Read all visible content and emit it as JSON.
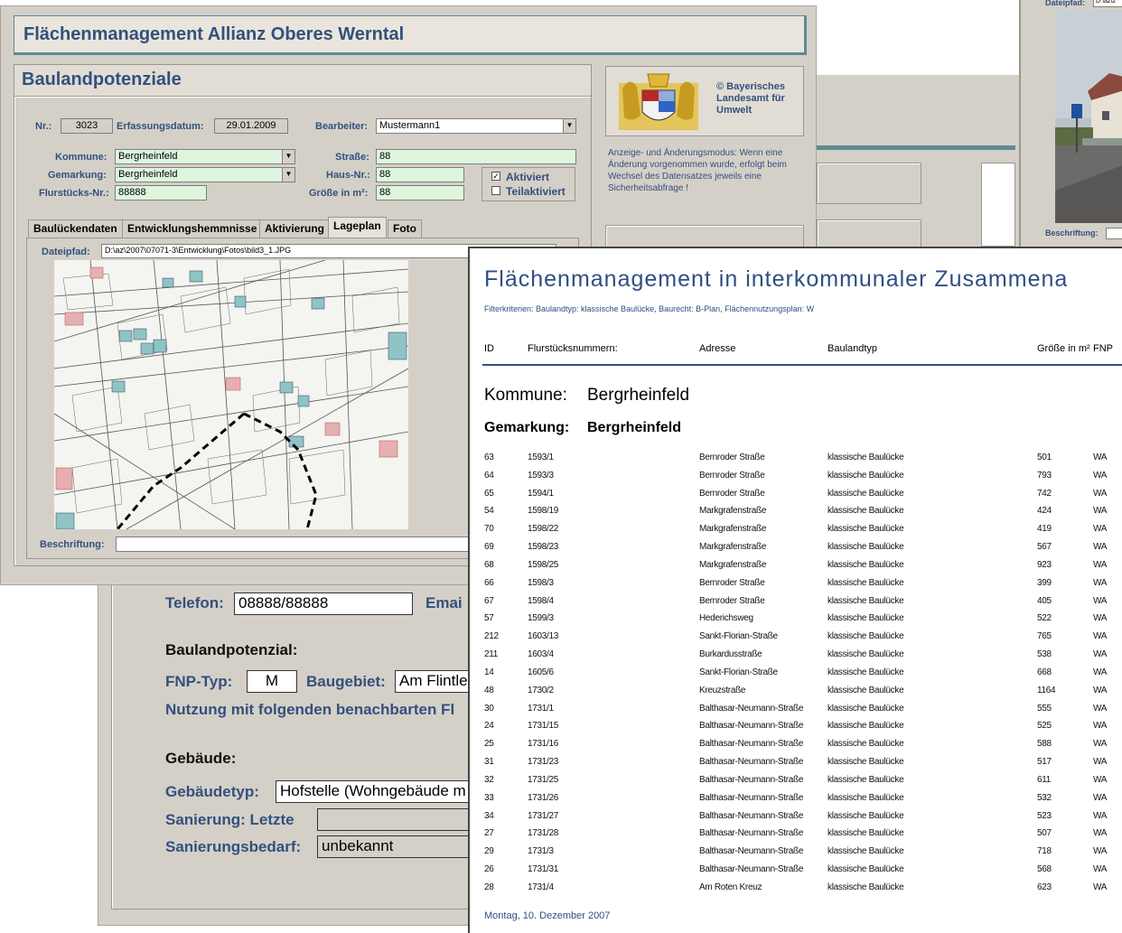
{
  "main_window": {
    "title": "Flächenmanagement Allianz Oberes Werntal",
    "section_title": "Baulandpotenziale",
    "nr_label": "Nr.:",
    "nr_value": "3023",
    "erfassung_label": "Erfassungsdatum:",
    "erfassung_value": "29.01.2009",
    "bearbeiter_label": "Bearbeiter:",
    "bearbeiter_value": "Mustermann1",
    "kommune_label": "Kommune:",
    "kommune_value": "Bergrheinfeld",
    "gemarkung_label": "Gemarkung:",
    "gemarkung_value": "Bergrheinfeld",
    "flurstueck_label": "Flurstücks-Nr.:",
    "flurstueck_value": "88888",
    "strasse_label": "Straße:",
    "strasse_value": "88",
    "hausnr_label": "Haus-Nr.:",
    "hausnr_value": "88",
    "groesse_label": "Größe in m²:",
    "groesse_value": "88",
    "aktiviert_label": "Aktiviert",
    "aktiviert_checked": true,
    "teilaktiviert_label": "Teilaktiviert",
    "teilaktiviert_checked": false,
    "tabs": [
      "Baulückendaten",
      "Entwicklungshemmnisse",
      "Aktivierung",
      "Lageplan",
      "Foto"
    ],
    "active_tab": "Lageplan",
    "dateipfad_label": "Dateipfad:",
    "dateipfad_value": "D:\\az\\2007\\07071-3\\Entwicklung\\Fotos\\bild3_1.JPG",
    "beschriftung_label": "Beschriftung:",
    "beschriftung_value": ""
  },
  "logo_panel": {
    "text": "© Bayerisches Landesamt für Umwelt"
  },
  "info_text": "Anzeige- und Änderungsmodus: Wenn eine Änderung vorgenommen wurde, erfolgt beim Wechsel des Datensatzes jeweils eine Sicherheitsabfrage !",
  "photo_window": {
    "dateipfad_label": "Dateipfad:",
    "dateipfad_value": "D:\\az\\2",
    "beschriftung_label": "Beschriftung:"
  },
  "contact_window": {
    "telefon_label": "Telefon:",
    "telefon_value": "08888/88888",
    "email_label": "Emai",
    "baulandpotenzial_heading": "Baulandpotenzial:",
    "fnp_label": "FNP-Typ:",
    "fnp_value": "M",
    "baugebiet_label": "Baugebiet:",
    "baugebiet_value": "Am Flintle",
    "nutzung_text": "Nutzung mit folgenden benachbarten Fl",
    "gebaeude_heading": "Gebäude:",
    "gebaeudetyp_label": "Gebäudetyp:",
    "gebaeudetyp_value": "Hofstelle (Wohngebäude m",
    "sanierung_label": "Sanierung:  Letzte",
    "sanierung_value": "",
    "sanierungsbedarf_label": "Sanierungsbedarf:",
    "sanierungsbedarf_value": "unbekannt"
  },
  "report": {
    "title": "Flächenmanagement in interkommunaler Zusammena",
    "filter": "Filterkriterien: Baulandtyp: klassische Baulücke, Baurecht: B-Plan, Flächennutzungsplan: W",
    "columns": {
      "id": "ID",
      "flurstueck": "Flurstücksnummern:",
      "adresse": "Adresse",
      "baulandtyp": "Baulandtyp",
      "groesse": "Größe in m²",
      "fnp": "FNP"
    },
    "kommune_label": "Kommune:",
    "kommune_value": "Bergrheinfeld",
    "gemarkung_label": "Gemarkung:",
    "gemarkung_value": "Bergrheinfeld",
    "rows": [
      {
        "id": "63",
        "fl": "1593/1",
        "adr": "Bernroder Straße",
        "typ": "klassische Baulücke",
        "gr": "501",
        "fnp": "WA"
      },
      {
        "id": "64",
        "fl": "1593/3",
        "adr": "Bernroder Straße",
        "typ": "klassische Baulücke",
        "gr": "793",
        "fnp": "WA"
      },
      {
        "id": "65",
        "fl": "1594/1",
        "adr": "Bernroder Straße",
        "typ": "klassische Baulücke",
        "gr": "742",
        "fnp": "WA"
      },
      {
        "id": "54",
        "fl": "1598/19",
        "adr": "Markgrafenstraße",
        "typ": "klassische Baulücke",
        "gr": "424",
        "fnp": "WA"
      },
      {
        "id": "70",
        "fl": "1598/22",
        "adr": "Markgrafenstraße",
        "typ": "klassische Baulücke",
        "gr": "419",
        "fnp": "WA"
      },
      {
        "id": "69",
        "fl": "1598/23",
        "adr": "Markgrafenstraße",
        "typ": "klassische Baulücke",
        "gr": "567",
        "fnp": "WA"
      },
      {
        "id": "68",
        "fl": "1598/25",
        "adr": "Markgrafenstraße",
        "typ": "klassische Baulücke",
        "gr": "923",
        "fnp": "WA"
      },
      {
        "id": "66",
        "fl": "1598/3",
        "adr": "Bernroder Straße",
        "typ": "klassische Baulücke",
        "gr": "399",
        "fnp": "WA"
      },
      {
        "id": "67",
        "fl": "1598/4",
        "adr": "Bernroder Straße",
        "typ": "klassische Baulücke",
        "gr": "405",
        "fnp": "WA"
      },
      {
        "id": "57",
        "fl": "1599/3",
        "adr": "Hederichsweg",
        "typ": "klassische Baulücke",
        "gr": "522",
        "fnp": "WA"
      },
      {
        "id": "212",
        "fl": "1603/13",
        "adr": "Sankt-Florian-Straße",
        "typ": "klassische Baulücke",
        "gr": "765",
        "fnp": "WA"
      },
      {
        "id": "211",
        "fl": "1603/4",
        "adr": "Burkardusstraße",
        "typ": "klassische Baulücke",
        "gr": "538",
        "fnp": "WA"
      },
      {
        "id": "14",
        "fl": "1605/6",
        "adr": "Sankt-Florian-Straße",
        "typ": "klassische Baulücke",
        "gr": "668",
        "fnp": "WA"
      },
      {
        "id": "48",
        "fl": "1730/2",
        "adr": "Kreuzstraße",
        "typ": "klassische Baulücke",
        "gr": "1164",
        "fnp": "WA"
      },
      {
        "id": "30",
        "fl": "1731/1",
        "adr": "Balthasar-Neumann-Straße",
        "typ": "klassische Baulücke",
        "gr": "555",
        "fnp": "WA"
      },
      {
        "id": "24",
        "fl": "1731/15",
        "adr": "Balthasar-Neumann-Straße",
        "typ": "klassische Baulücke",
        "gr": "525",
        "fnp": "WA"
      },
      {
        "id": "25",
        "fl": "1731/16",
        "adr": "Balthasar-Neumann-Straße",
        "typ": "klassische Baulücke",
        "gr": "588",
        "fnp": "WA"
      },
      {
        "id": "31",
        "fl": "1731/23",
        "adr": "Balthasar-Neumann-Straße",
        "typ": "klassische Baulücke",
        "gr": "517",
        "fnp": "WA"
      },
      {
        "id": "32",
        "fl": "1731/25",
        "adr": "Balthasar-Neumann-Straße",
        "typ": "klassische Baulücke",
        "gr": "611",
        "fnp": "WA"
      },
      {
        "id": "33",
        "fl": "1731/26",
        "adr": "Balthasar-Neumann-Straße",
        "typ": "klassische Baulücke",
        "gr": "532",
        "fnp": "WA"
      },
      {
        "id": "34",
        "fl": "1731/27",
        "adr": "Balthasar-Neumann-Straße",
        "typ": "klassische Baulücke",
        "gr": "523",
        "fnp": "WA"
      },
      {
        "id": "27",
        "fl": "1731/28",
        "adr": "Balthasar-Neumann-Straße",
        "typ": "klassische Baulücke",
        "gr": "507",
        "fnp": "WA"
      },
      {
        "id": "29",
        "fl": "1731/3",
        "adr": "Balthasar-Neumann-Straße",
        "typ": "klassische Baulücke",
        "gr": "718",
        "fnp": "WA"
      },
      {
        "id": "26",
        "fl": "1731/31",
        "adr": "Balthasar-Neumann-Straße",
        "typ": "klassische Baulücke",
        "gr": "568",
        "fnp": "WA"
      },
      {
        "id": "28",
        "fl": "1731/4",
        "adr": "Am Roten Kreuz",
        "typ": "klassische Baulücke",
        "gr": "623",
        "fnp": "WA"
      }
    ],
    "footer_date": "Montag, 10. Dezember 2007"
  }
}
